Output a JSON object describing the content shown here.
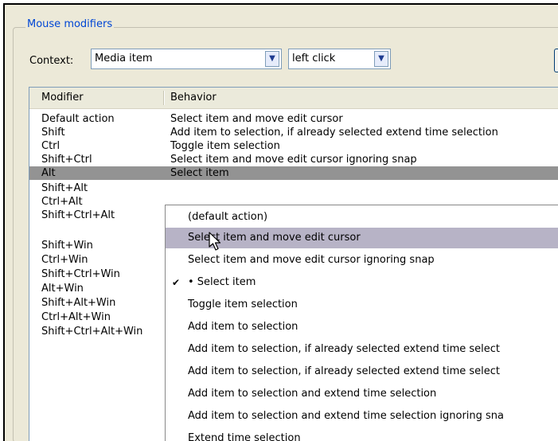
{
  "group_title": "Mouse modifiers",
  "context": {
    "label": "Context:",
    "combo1_value": "Media item",
    "combo2_value": "left click"
  },
  "table": {
    "headers": [
      "Modifier",
      "Behavior"
    ],
    "rows": [
      {
        "modifier": "Default action",
        "behavior": "Select item and move edit cursor"
      },
      {
        "modifier": "Shift",
        "behavior": "Add item to selection, if already selected extend time selection"
      },
      {
        "modifier": "Ctrl",
        "behavior": "Toggle item selection"
      },
      {
        "modifier": "Shift+Ctrl",
        "behavior": "Select item and move edit cursor ignoring snap"
      },
      {
        "modifier": "Alt",
        "behavior": "Select item"
      }
    ],
    "extra_modifiers": [
      "Shift+Alt",
      "Ctrl+Alt",
      "Shift+Ctrl+Alt",
      "Shift+Win",
      "Ctrl+Win",
      "Shift+Ctrl+Win",
      "Alt+Win",
      "Shift+Alt+Win",
      "Ctrl+Alt+Win",
      "Shift+Ctrl+Alt+Win"
    ]
  },
  "menu": {
    "items": [
      "(default action)",
      "Select item and move edit cursor",
      "Select item and move edit cursor ignoring snap",
      "• Select item",
      "Toggle item selection",
      "Add item to selection",
      "Add item to selection, if already selected extend time select",
      "Add item to selection, if already selected extend time select",
      "Add item to selection and extend time selection",
      "Add item to selection and extend time selection ignoring sna",
      "Extend time selection"
    ],
    "checked_index": 3,
    "highlighted_index": 1
  }
}
